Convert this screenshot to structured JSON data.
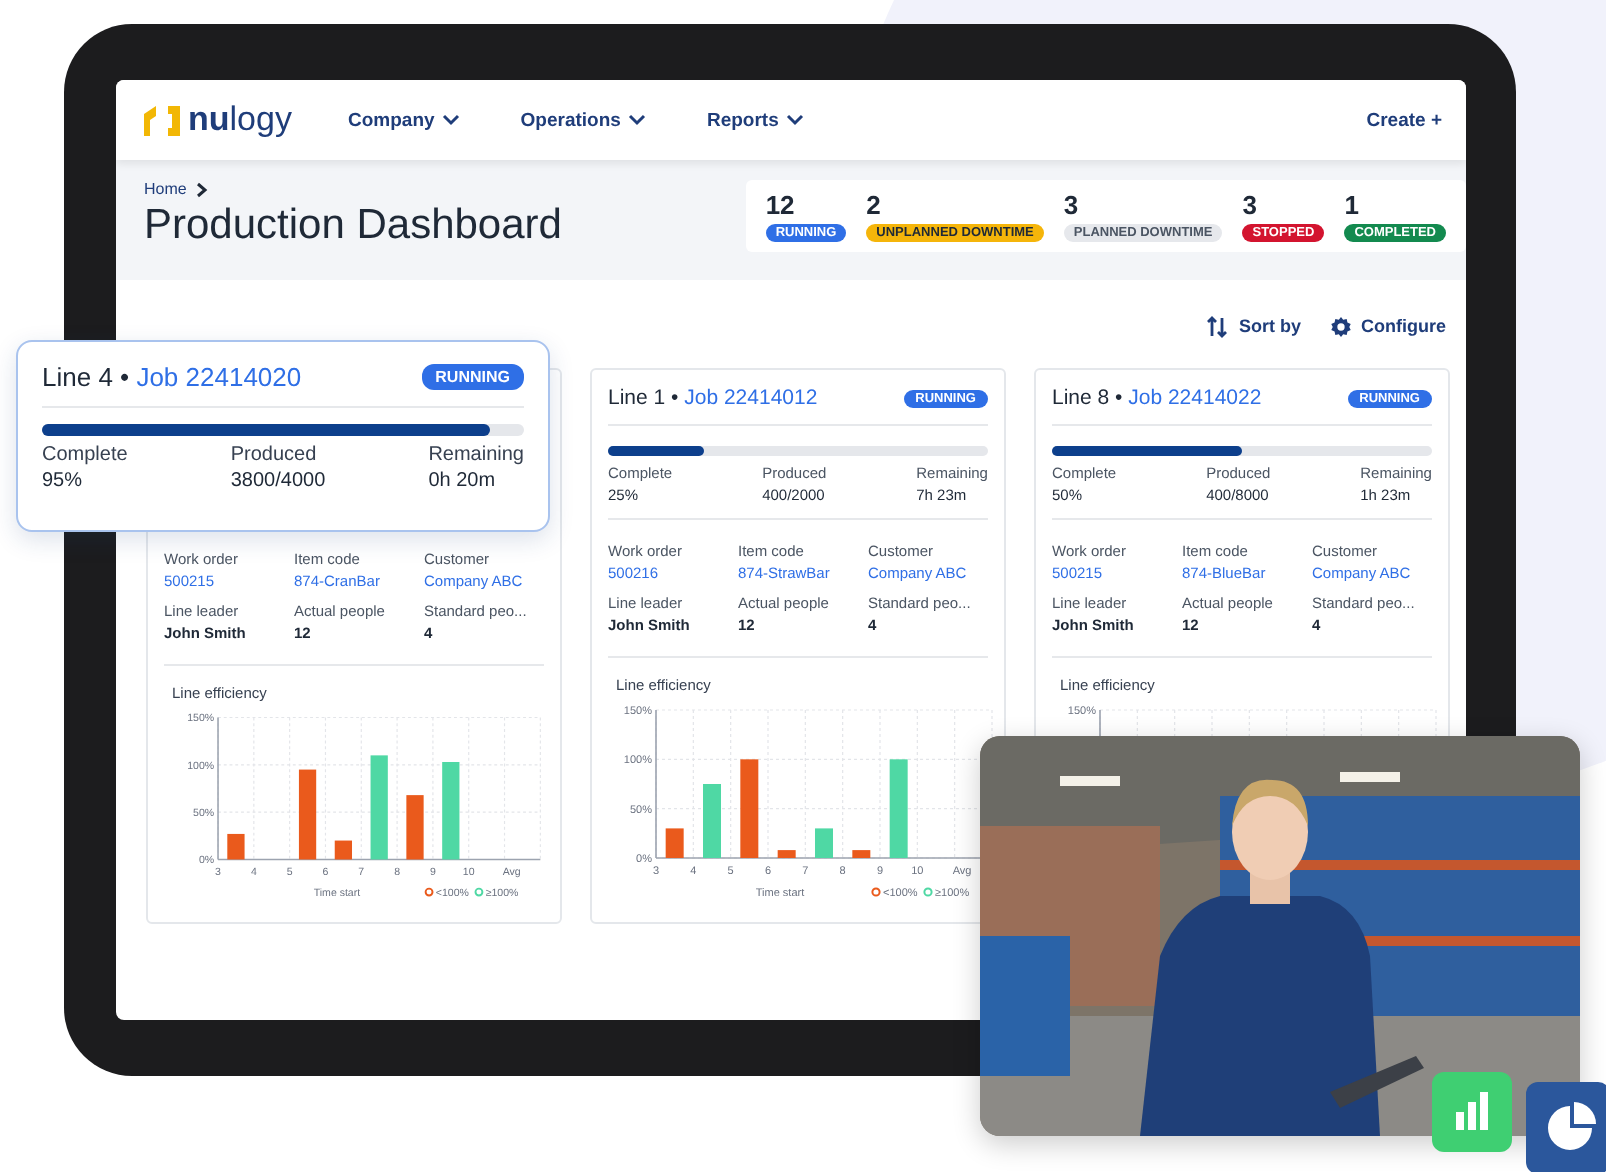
{
  "nav": {
    "logo": "**nu**logy",
    "menu": [
      {
        "label": "Company"
      },
      {
        "label": "Operations"
      },
      {
        "label": "Reports"
      }
    ],
    "action": "Create +"
  },
  "header": {
    "breadcrumb": "Home",
    "title": "Production Dashboard",
    "summary": [
      {
        "count": "12",
        "label": "RUNNING",
        "color": "#2f6fe6"
      },
      {
        "count": "2",
        "label": "UNPLANNED DOWNTIME",
        "color": "#f5b50a"
      },
      {
        "count": "3",
        "label": "PLANNED DOWNTIME",
        "color": "#e6e8ec"
      },
      {
        "count": "3",
        "label": "STOPPED",
        "color": "#d3142f"
      },
      {
        "count": "1",
        "label": "COMPLETED",
        "color": "#138a4f"
      }
    ]
  },
  "toolbar": {
    "sort": "Sort by",
    "configure": "Configure"
  },
  "highlight_card": {
    "line": "Line 4",
    "separator": "•",
    "job": "Job 22414020",
    "status": "RUNNING",
    "level": 0.93,
    "stats": [
      {
        "label": "Complete",
        "value": "95%"
      },
      {
        "label": "Produced",
        "value": "3800/4000"
      },
      {
        "label": "Remaining",
        "value": "0h 20m"
      }
    ]
  },
  "cards": [
    {
      "details": [
        {
          "label": "Work order",
          "value": "500215",
          "link": true
        },
        {
          "label": "Item code",
          "value": "874-CranBar",
          "link": true
        },
        {
          "label": "Customer",
          "value": "Company ABC",
          "link": true
        },
        {
          "label": "Line leader",
          "value": "John Smith",
          "link": false
        },
        {
          "label": "Actual people",
          "value": "12",
          "link": false
        },
        {
          "label": "Standard peo...",
          "value": "4",
          "link": false
        }
      ],
      "chart_data": {
        "type": "bar",
        "title": "Line efficiency",
        "xlabel": "Time start",
        "grid": true,
        "categories": [
          "3",
          "4",
          "5",
          "6",
          "7",
          "8",
          "9",
          "10",
          "Avg"
        ],
        "ylim": [
          0,
          150
        ],
        "yticks": [
          {
            "value": 0,
            "label": "0%"
          },
          {
            "value": 50,
            "label": "50%"
          },
          {
            "value": 100,
            "label": "100%"
          },
          {
            "value": 150,
            "label": "150%"
          }
        ],
        "legend": "bottom-right",
        "series": [
          {
            "name": "<100%",
            "color": "#ea5a1c",
            "values": [
              27,
              null,
              95,
              20,
              null,
              68,
              null,
              null,
              null
            ]
          },
          {
            "name": "≥100%",
            "color": "#4fd8a4",
            "values": [
              null,
              null,
              null,
              null,
              110,
              null,
              103,
              null,
              null
            ]
          }
        ]
      }
    },
    {
      "line": "Line 1",
      "separator": "•",
      "job": "Job 22414012",
      "status": "RUNNING",
      "level": 0.25,
      "stats": [
        {
          "label": "Complete",
          "value": "25%"
        },
        {
          "label": "Produced",
          "value": "400/2000"
        },
        {
          "label": "Remaining",
          "value": "7h 23m"
        }
      ],
      "details": [
        {
          "label": "Work order",
          "value": "500216",
          "link": true
        },
        {
          "label": "Item code",
          "value": "874-StrawBar",
          "link": true
        },
        {
          "label": "Customer",
          "value": "Company ABC",
          "link": true
        },
        {
          "label": "Line leader",
          "value": "John Smith",
          "link": false
        },
        {
          "label": "Actual people",
          "value": "12",
          "link": false
        },
        {
          "label": "Standard peo...",
          "value": "4",
          "link": false
        }
      ],
      "chart_data": {
        "type": "bar",
        "title": "Line efficiency",
        "xlabel": "Time start",
        "grid": true,
        "categories": [
          "3",
          "4",
          "5",
          "6",
          "7",
          "8",
          "9",
          "10",
          "Avg"
        ],
        "ylim": [
          0,
          150
        ],
        "yticks": [
          {
            "value": 0,
            "label": "0%"
          },
          {
            "value": 50,
            "label": "50%"
          },
          {
            "value": 100,
            "label": "100%"
          },
          {
            "value": 150,
            "label": "150%"
          }
        ],
        "legend": "bottom-right",
        "series": [
          {
            "name": "<100%",
            "color": "#ea5a1c",
            "values": [
              30,
              null,
              100,
              8,
              null,
              8,
              null,
              null,
              null
            ]
          },
          {
            "name": "≥100%",
            "color": "#4fd8a4",
            "values": [
              null,
              75,
              null,
              null,
              30,
              null,
              100,
              null,
              null
            ]
          }
        ]
      }
    },
    {
      "line": "Line 8",
      "separator": "•",
      "job": "Job 22414022",
      "status": "RUNNING",
      "level": 0.5,
      "stats": [
        {
          "label": "Complete",
          "value": "50%"
        },
        {
          "label": "Produced",
          "value": "400/8000"
        },
        {
          "label": "Remaining",
          "value": "1h 23m"
        }
      ],
      "details": [
        {
          "label": "Work order",
          "value": "500215",
          "link": true
        },
        {
          "label": "Item code",
          "value": "874-BlueBar",
          "link": true
        },
        {
          "label": "Customer",
          "value": "Company ABC",
          "link": true
        },
        {
          "label": "Line leader",
          "value": "John Smith",
          "link": false
        },
        {
          "label": "Actual people",
          "value": "12",
          "link": false
        },
        {
          "label": "Standard peo...",
          "value": "4",
          "link": false
        }
      ],
      "chart_data": {
        "type": "other",
        "title": "Line efficiency",
        "annotations": [
          {
            "text": "150%"
          }
        ]
      }
    }
  ]
}
